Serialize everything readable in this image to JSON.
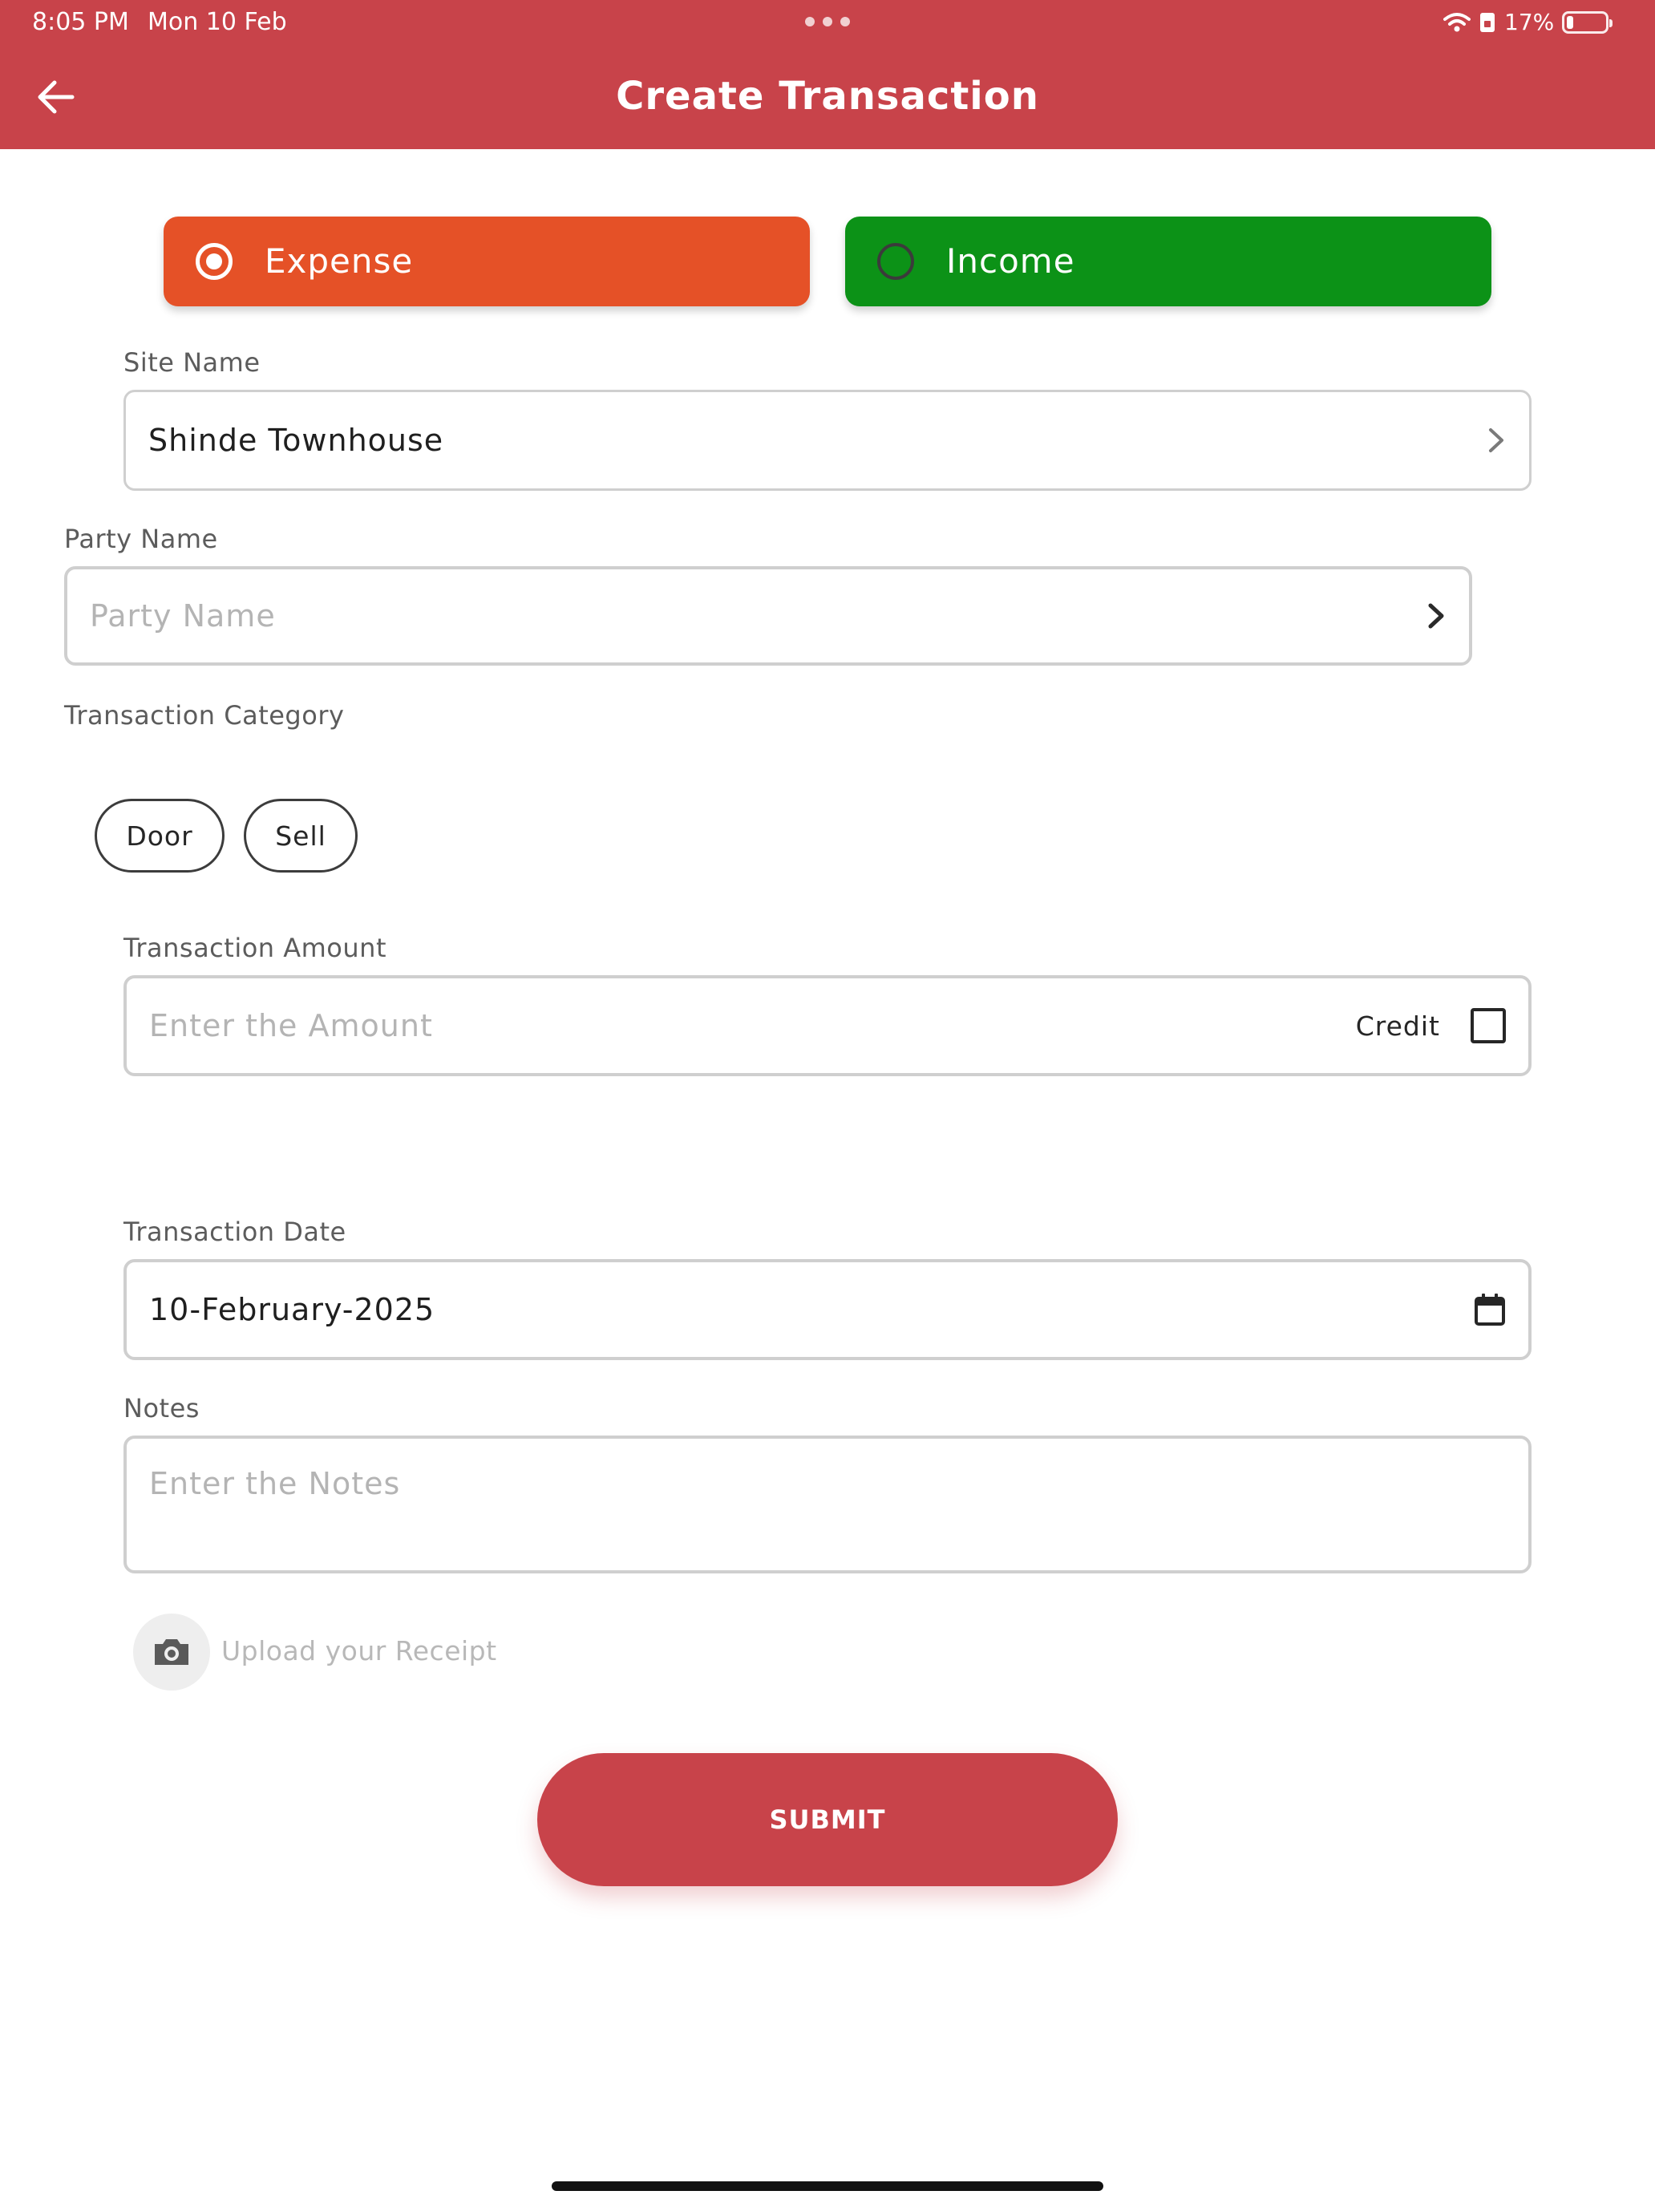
{
  "status_bar": {
    "time": "8:05 PM",
    "date": "Mon 10 Feb",
    "battery": "17%"
  },
  "header": {
    "title": "Create Transaction",
    "back_icon": "arrow-left-icon",
    "background_color": "#c8434a"
  },
  "transaction_type": {
    "options": [
      {
        "label": "Expense",
        "selected": true,
        "color": "#e55127"
      },
      {
        "label": "Income",
        "selected": false,
        "color": "#0c9217"
      }
    ]
  },
  "site": {
    "label": "Site Name",
    "value": "Shinde Townhouse",
    "icon": "chevron-right-icon"
  },
  "party": {
    "label": "Party Name",
    "placeholder": "Party Name",
    "icon": "chevron-right-icon"
  },
  "category": {
    "label": "Transaction Category",
    "chips": [
      "Door",
      "Sell"
    ]
  },
  "amount": {
    "label": "Transaction Amount",
    "placeholder": "Enter the Amount",
    "credit_label": "Credit",
    "credit_checked": false
  },
  "date": {
    "label": "Transaction Date",
    "value": "10-February-2025",
    "icon": "calendar-icon"
  },
  "notes": {
    "label": "Notes",
    "placeholder": "Enter the Notes"
  },
  "upload": {
    "label": "Upload your Receipt",
    "icon": "camera-icon"
  },
  "submit": {
    "label": "SUBMIT",
    "color": "#c8434a"
  }
}
